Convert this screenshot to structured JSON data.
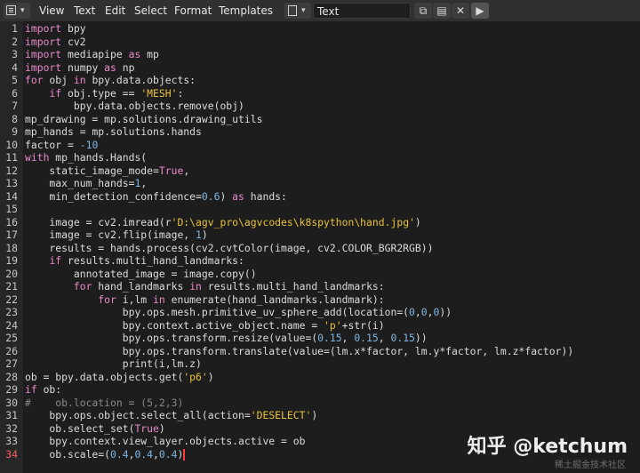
{
  "header": {
    "menus": [
      "View",
      "Text",
      "Edit",
      "Select",
      "Format",
      "Templates"
    ],
    "text_name": "Text",
    "buttons": [
      "new-icon",
      "open-icon",
      "close-icon",
      "run-icon"
    ]
  },
  "code": {
    "lines": [
      [
        {
          "t": "import",
          "c": "k"
        },
        {
          "t": " bpy"
        }
      ],
      [
        {
          "t": "import",
          "c": "k"
        },
        {
          "t": " cv2"
        }
      ],
      [
        {
          "t": "import",
          "c": "k"
        },
        {
          "t": " mediapipe "
        },
        {
          "t": "as",
          "c": "k"
        },
        {
          "t": " mp"
        }
      ],
      [
        {
          "t": "import",
          "c": "k"
        },
        {
          "t": " numpy "
        },
        {
          "t": "as",
          "c": "k"
        },
        {
          "t": " np"
        }
      ],
      [
        {
          "t": "for",
          "c": "k"
        },
        {
          "t": " obj "
        },
        {
          "t": "in",
          "c": "k"
        },
        {
          "t": " bpy.data.objects:"
        }
      ],
      [
        {
          "t": "    "
        },
        {
          "t": "if",
          "c": "k"
        },
        {
          "t": " obj.type == "
        },
        {
          "t": "'MESH'",
          "c": "s"
        },
        {
          "t": ":"
        }
      ],
      [
        {
          "t": "        bpy.data.objects.remove(obj)"
        }
      ],
      [
        {
          "t": "mp_drawing = mp.solutions.drawing_utils"
        }
      ],
      [
        {
          "t": "mp_hands = mp.solutions.hands"
        }
      ],
      [
        {
          "t": "factor = "
        },
        {
          "t": "-10",
          "c": "n"
        }
      ],
      [
        {
          "t": "with",
          "c": "k"
        },
        {
          "t": " mp_hands.Hands("
        }
      ],
      [
        {
          "t": "    static_image_mode="
        },
        {
          "t": "True",
          "c": "k"
        },
        {
          "t": ","
        }
      ],
      [
        {
          "t": "    max_num_hands="
        },
        {
          "t": "1",
          "c": "n"
        },
        {
          "t": ","
        }
      ],
      [
        {
          "t": "    min_detection_confidence="
        },
        {
          "t": "0.6",
          "c": "n"
        },
        {
          "t": ") "
        },
        {
          "t": "as",
          "c": "k"
        },
        {
          "t": " hands:"
        }
      ],
      [
        {
          "t": ""
        }
      ],
      [
        {
          "t": "    image = cv2.imread(r"
        },
        {
          "t": "'D:\\agv_pro\\agvcodes\\k8spython\\hand.jpg'",
          "c": "s"
        },
        {
          "t": ")"
        }
      ],
      [
        {
          "t": "    image = cv2.flip(image, "
        },
        {
          "t": "1",
          "c": "n"
        },
        {
          "t": ")"
        }
      ],
      [
        {
          "t": "    results = hands.process(cv2.cvtColor(image, cv2.COLOR_BGR2RGB))"
        }
      ],
      [
        {
          "t": "    "
        },
        {
          "t": "if",
          "c": "k"
        },
        {
          "t": " results.multi_hand_landmarks:"
        }
      ],
      [
        {
          "t": "        annotated_image = image.copy()"
        }
      ],
      [
        {
          "t": "        "
        },
        {
          "t": "for",
          "c": "k"
        },
        {
          "t": " hand_landmarks "
        },
        {
          "t": "in",
          "c": "k"
        },
        {
          "t": " results.multi_hand_landmarks:"
        }
      ],
      [
        {
          "t": "            "
        },
        {
          "t": "for",
          "c": "k"
        },
        {
          "t": " i,lm "
        },
        {
          "t": "in",
          "c": "k"
        },
        {
          "t": " enumerate(hand_landmarks.landmark):"
        }
      ],
      [
        {
          "t": "                bpy.ops.mesh.primitive_uv_sphere_add(location=("
        },
        {
          "t": "0",
          "c": "n"
        },
        {
          "t": ","
        },
        {
          "t": "0",
          "c": "n"
        },
        {
          "t": ","
        },
        {
          "t": "0",
          "c": "n"
        },
        {
          "t": "))"
        }
      ],
      [
        {
          "t": "                bpy.context.active_object.name = "
        },
        {
          "t": "'p'",
          "c": "s"
        },
        {
          "t": "+str(i)"
        }
      ],
      [
        {
          "t": "                bpy.ops.transform.resize(value=("
        },
        {
          "t": "0.15",
          "c": "n"
        },
        {
          "t": ", "
        },
        {
          "t": "0.15",
          "c": "n"
        },
        {
          "t": ", "
        },
        {
          "t": "0.15",
          "c": "n"
        },
        {
          "t": "))"
        }
      ],
      [
        {
          "t": "                bpy.ops.transform.translate(value=(lm.x*factor, lm.y*factor, lm.z*factor))"
        }
      ],
      [
        {
          "t": "                print(i,lm.z)"
        }
      ],
      [
        {
          "t": "ob = bpy.data.objects.get("
        },
        {
          "t": "'p6'",
          "c": "s"
        },
        {
          "t": ")"
        }
      ],
      [
        {
          "t": "if",
          "c": "k"
        },
        {
          "t": " ob:"
        }
      ],
      [
        {
          "t": "#    ob.location = (5,2,3)",
          "c": "c"
        }
      ],
      [
        {
          "t": "    bpy.ops.object.select_all(action="
        },
        {
          "t": "'DESELECT'",
          "c": "s"
        },
        {
          "t": ")"
        }
      ],
      [
        {
          "t": "    ob.select_set("
        },
        {
          "t": "True",
          "c": "k"
        },
        {
          "t": ")"
        }
      ],
      [
        {
          "t": "    bpy.context.view_layer.objects.active = ob"
        }
      ],
      [
        {
          "t": "    ob.scale=("
        },
        {
          "t": "0.4",
          "c": "n"
        },
        {
          "t": ","
        },
        {
          "t": "0.4",
          "c": "n"
        },
        {
          "t": ","
        },
        {
          "t": "0.4",
          "c": "n"
        },
        {
          "t": ")"
        }
      ]
    ],
    "current_line": 34
  },
  "watermark": {
    "main": "知乎 @ketchum",
    "sub": "稀土掘金技术社区"
  }
}
